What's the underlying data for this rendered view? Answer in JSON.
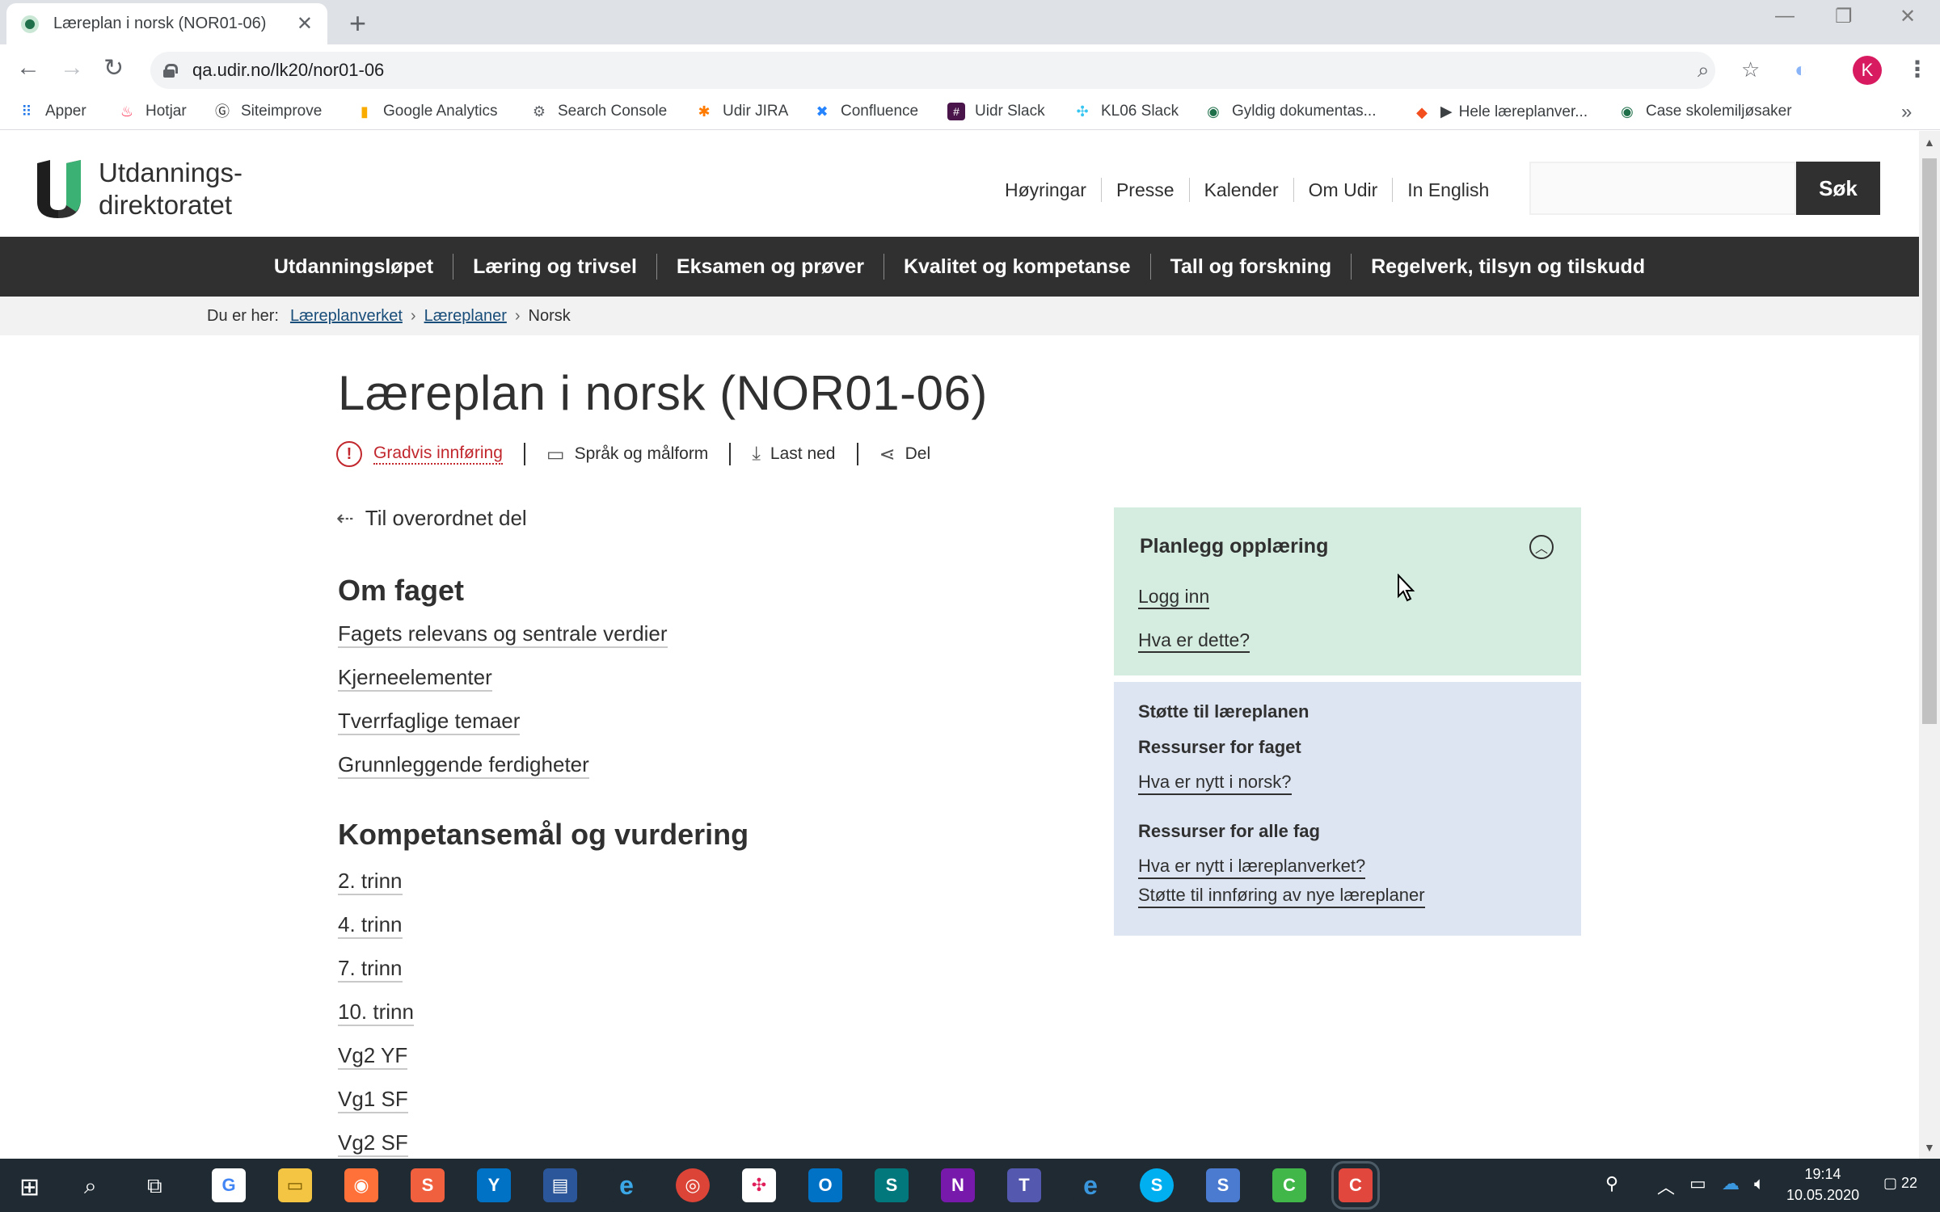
{
  "browser": {
    "tab_title": "Læreplan i norsk (NOR01-06)",
    "url": "qa.udir.no/lk20/nor01-06",
    "avatar_letter": "K",
    "bookmarks": [
      {
        "label": "Apper",
        "icon": "apps-grid-icon",
        "color": "#1a73e8"
      },
      {
        "label": "Hotjar",
        "icon": "hotjar-flame-icon",
        "color": "#fd3a5c"
      },
      {
        "label": "Siteimprove",
        "icon": "siteimprove-icon",
        "color": "#333333"
      },
      {
        "label": "Google Analytics",
        "icon": "analytics-icon",
        "color": "#f9ab00"
      },
      {
        "label": "Search Console",
        "icon": "search-console-icon",
        "color": "#5f6368"
      },
      {
        "label": "Udir JIRA",
        "icon": "jira-icon",
        "color": "#ff7a00"
      },
      {
        "label": "Confluence",
        "icon": "confluence-icon",
        "color": "#2684ff"
      },
      {
        "label": "Uidr Slack",
        "icon": "slack-icon",
        "color": "#4a154b"
      },
      {
        "label": "KL06 Slack",
        "icon": "slack-color-icon",
        "color": "#36c5f0"
      },
      {
        "label": "Gyldig dokumentas...",
        "icon": "udir-icon",
        "color": "#1f6f4a"
      },
      {
        "label": "Hele læreplanver...",
        "icon": "figma-icon",
        "color": "#f24e1e"
      },
      {
        "label": "Case skolemiljøsaker",
        "icon": "udir-icon",
        "color": "#1f6f4a"
      }
    ]
  },
  "site": {
    "logo_line1": "Utdannings-",
    "logo_line2": "direktoratet",
    "utility_nav": [
      "Høyringar",
      "Presse",
      "Kalender",
      "Om Udir",
      "In English"
    ],
    "search_button": "Søk",
    "main_nav": [
      "Utdanningsløpet",
      "Læring og trivsel",
      "Eksamen og prøver",
      "Kvalitet og kompetanse",
      "Tall og forskning",
      "Regelverk, tilsyn og tilskudd"
    ],
    "breadcrumb": {
      "prefix": "Du er her:",
      "items": [
        "Læreplanverket",
        "Læreplaner"
      ],
      "current": "Norsk"
    }
  },
  "content": {
    "title": "Læreplan i norsk (NOR01-06)",
    "tools": {
      "gradvis": "Gradvis innføring",
      "sprak": "Språk og målform",
      "lastned": "Last ned",
      "del": "Del"
    },
    "back_link": "Til overordnet del",
    "section1": {
      "title": "Om faget",
      "links": [
        "Fagets relevans og sentrale verdier",
        "Kjerneelementer",
        "Tverrfaglige temaer",
        "Grunnleggende ferdigheter"
      ]
    },
    "section2": {
      "title": "Kompetansemål og vurdering",
      "links": [
        "2. trinn",
        "4. trinn",
        "7. trinn",
        "10. trinn",
        "Vg2 YF",
        "Vg1 SF",
        "Vg2 SF"
      ]
    }
  },
  "aside": {
    "planlegg": {
      "title": "Planlegg opplæring",
      "login": "Logg inn",
      "what": "Hva er dette?"
    },
    "stotte": {
      "title": "Støtte til læreplanen",
      "fag_heading": "Ressurser for faget",
      "fag_link": "Hva er nytt i norsk?",
      "alle_heading": "Ressurser for alle fag",
      "alle_link1": "Hva er nytt i læreplanverket?",
      "alle_link2": "Støtte til innføring av nye læreplaner"
    }
  },
  "taskbar": {
    "time": "19:14",
    "date": "10.05.2020",
    "notifications": "22"
  }
}
